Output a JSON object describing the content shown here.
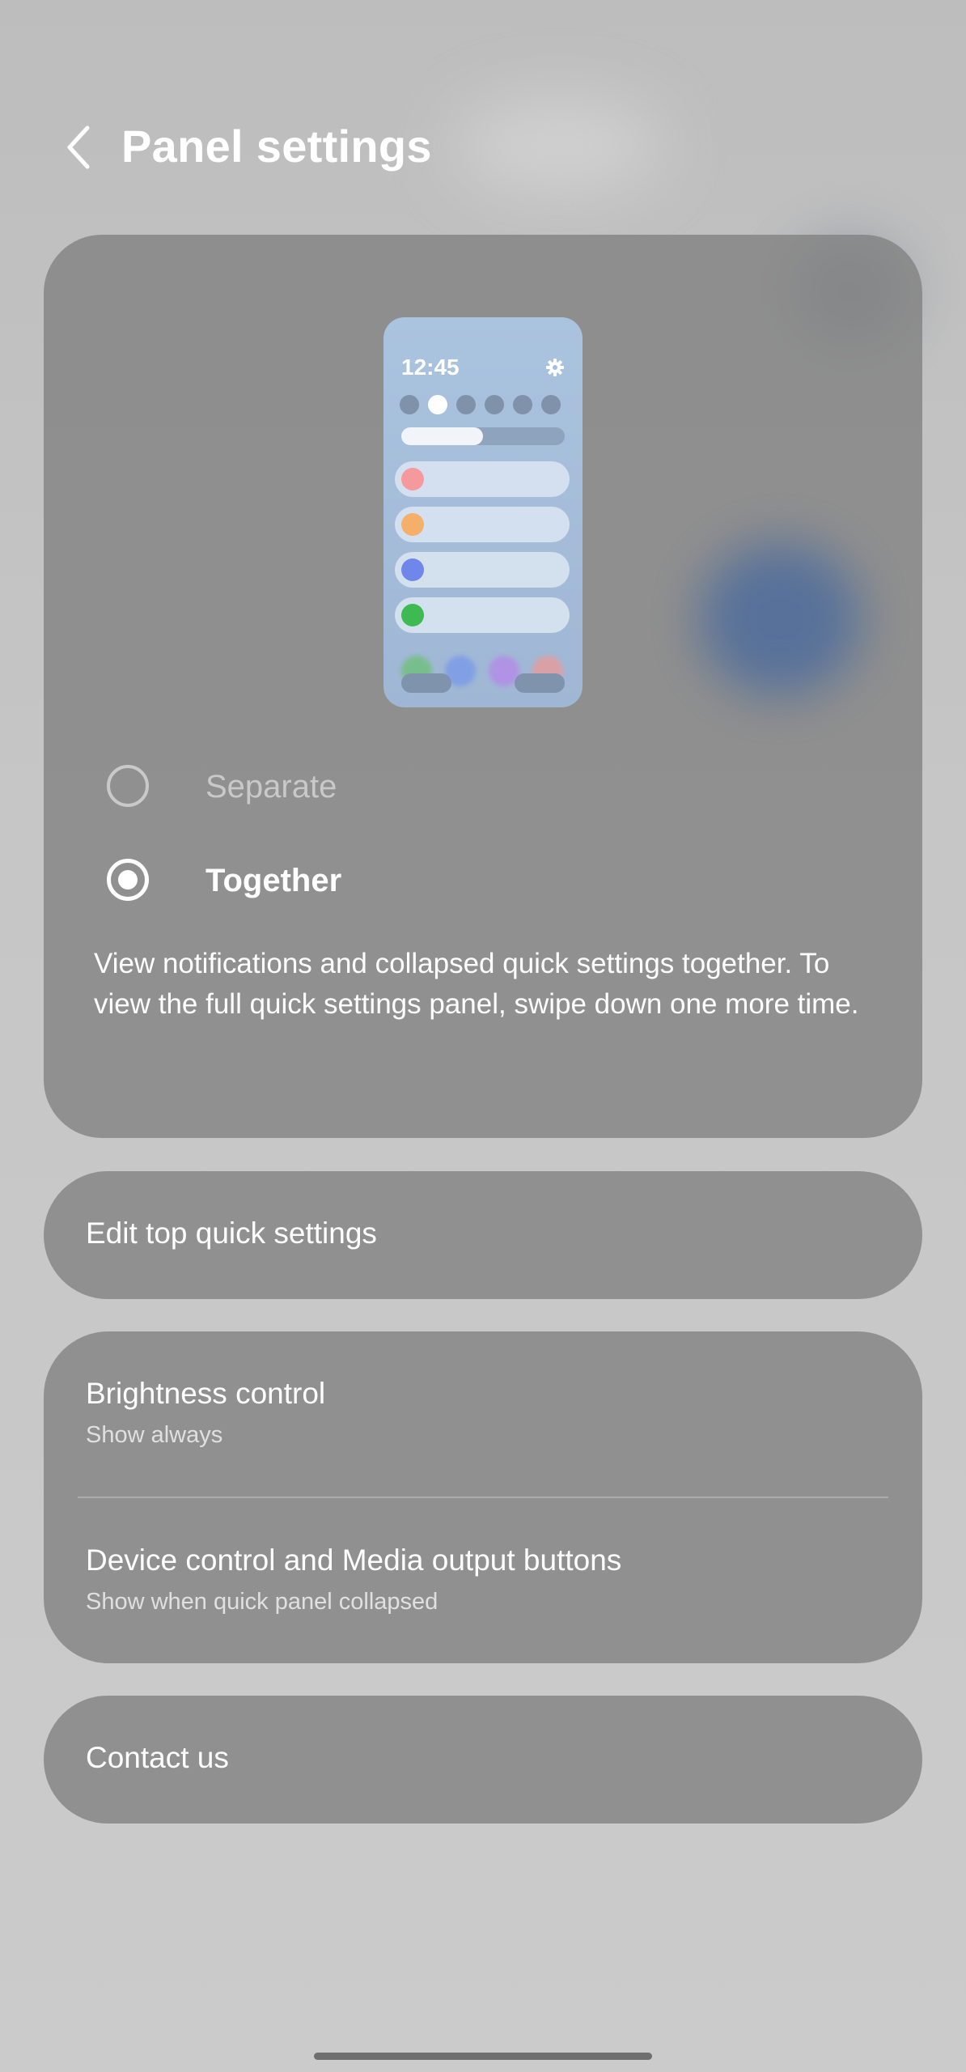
{
  "header": {
    "title": "Panel settings"
  },
  "preview": {
    "time": "12:45",
    "icon_settings": "gear-icon",
    "quick_setting_count": 6,
    "active_quick_setting_index": 1,
    "brightness_level": 0.5,
    "notification_colors": [
      "#f49a9c",
      "#f4b06a",
      "#6f86ea",
      "#3dbb52"
    ]
  },
  "layout_options": [
    {
      "label": "Separate",
      "selected": false
    },
    {
      "label": "Together",
      "selected": true
    }
  ],
  "description": "View notifications and collapsed quick settings together. To view the full quick settings panel, swipe down one more time.",
  "settings": {
    "edit_top": {
      "title": "Edit top quick settings"
    },
    "brightness": {
      "title": "Brightness control",
      "subtitle": "Show always"
    },
    "device_media": {
      "title": "Device control and Media output buttons",
      "subtitle": "Show when quick panel collapsed"
    },
    "contact": {
      "title": "Contact us"
    }
  }
}
